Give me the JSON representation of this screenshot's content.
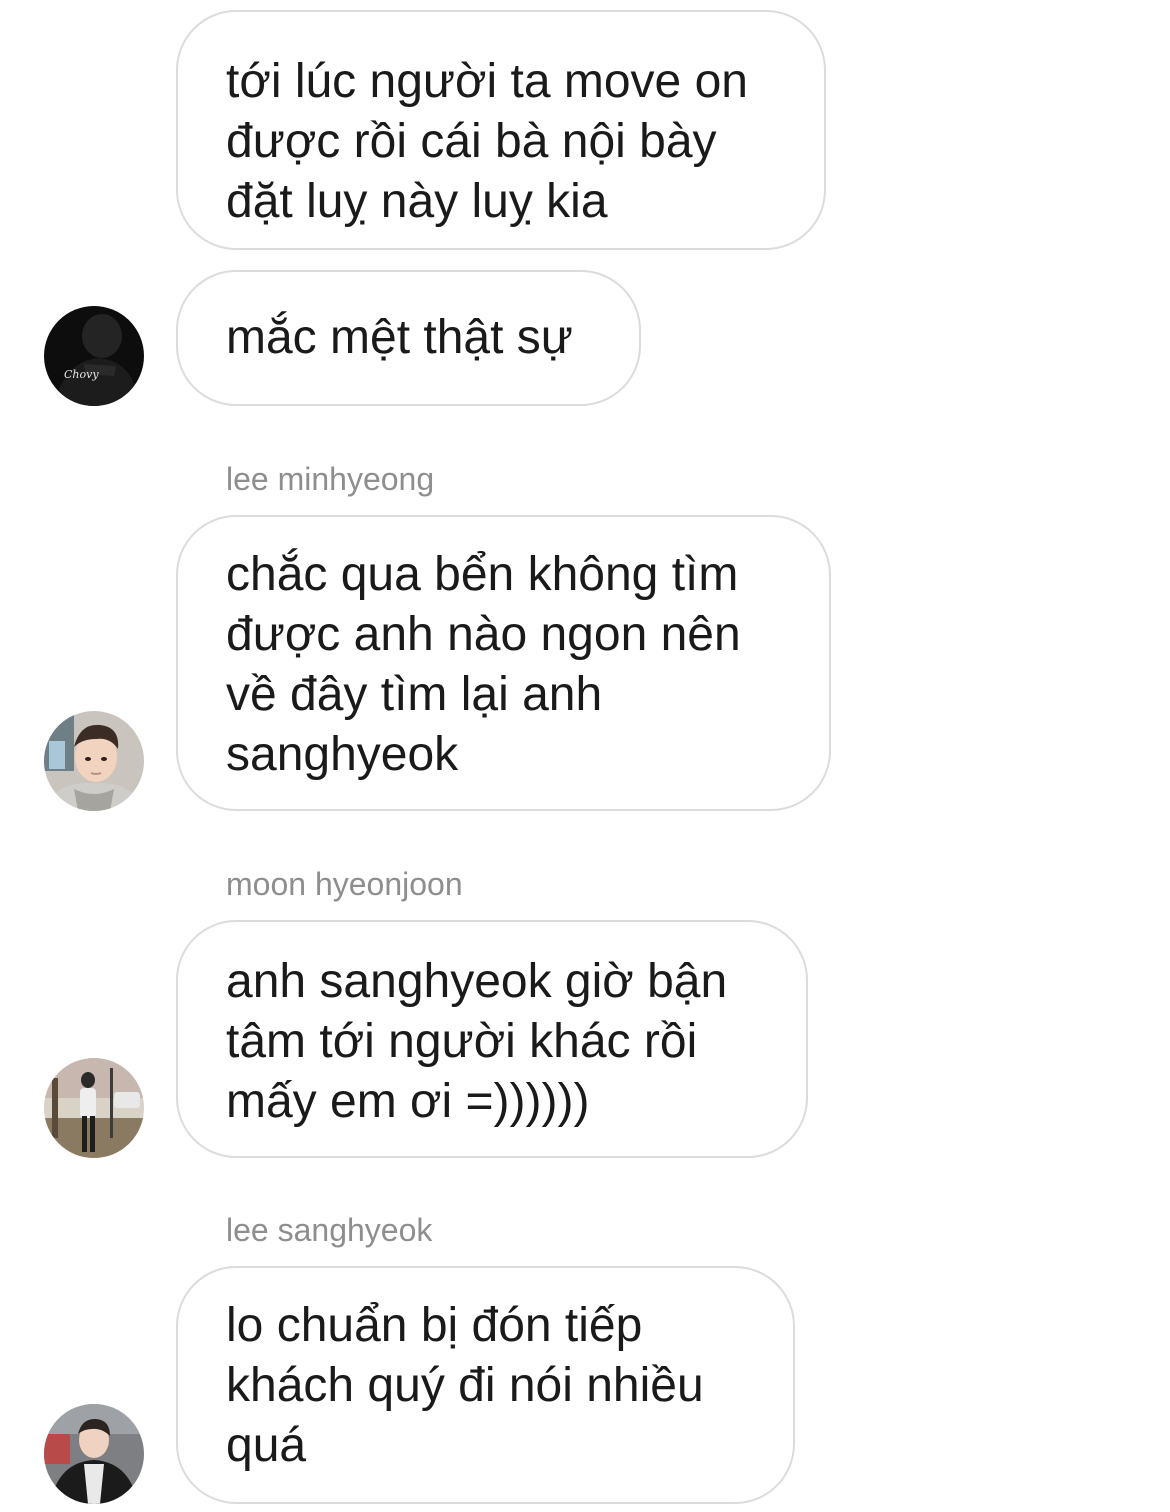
{
  "messages": [
    {
      "sender": "",
      "lines": [
        "tới lúc người ta move on",
        "được rồi cái bà nội bày",
        "đặt luỵ này luỵ kia"
      ]
    },
    {
      "sender": "",
      "lines": [
        "mắc mệt thật sự"
      ],
      "avatar": {
        "icon": "avatar-dark-hoodie",
        "text": "Chovy"
      }
    },
    {
      "sender": "lee minhyeong",
      "lines": [
        "chắc qua bển không tìm",
        "được anh nào ngon nên",
        "về đây tìm lại anh",
        "sanghyeok"
      ],
      "avatar": {
        "icon": "avatar-face-selfie"
      }
    },
    {
      "sender": "moon hyeonjoon",
      "lines": [
        "anh sanghyeok giờ bận",
        "tâm tới người khác rồi",
        "mấy em ơi =))))))"
      ],
      "avatar": {
        "icon": "avatar-street-photo"
      }
    },
    {
      "sender": "lee sanghyeok",
      "lines": [
        "lo chuẩn bị đón tiếp",
        "khách quý đi nói nhiều",
        "quá"
      ],
      "avatar": {
        "icon": "avatar-puffer-jacket"
      }
    }
  ],
  "colors": {
    "bubble_border": "#dcdcdc",
    "sender_text": "#8e8e8e",
    "message_text": "#1a1a1a",
    "background": "#ffffff"
  }
}
